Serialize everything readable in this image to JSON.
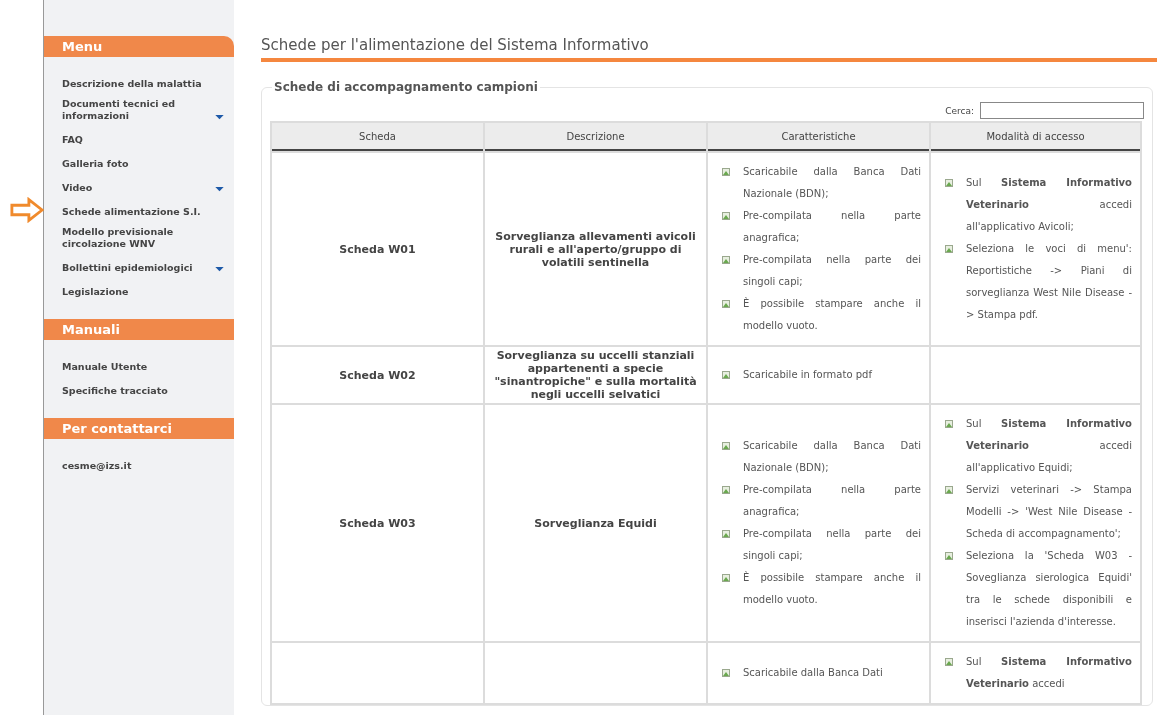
{
  "sidebar": {
    "sections": [
      {
        "title": "Menu",
        "items": [
          {
            "label": "Descrizione della malattia",
            "expandable": false,
            "selected": false
          },
          {
            "label": "Documenti tecnici ed informazioni",
            "expandable": true,
            "selected": false
          },
          {
            "label": "FAQ",
            "expandable": false,
            "selected": false
          },
          {
            "label": "Galleria foto",
            "expandable": false,
            "selected": false
          },
          {
            "label": "Video",
            "expandable": true,
            "selected": false
          },
          {
            "label": "Schede alimentazione S.I.",
            "expandable": false,
            "selected": true
          },
          {
            "label": "Modello previsionale circolazione WNV",
            "expandable": false,
            "selected": false
          },
          {
            "label": "Bollettini epidemiologici",
            "expandable": true,
            "selected": false
          },
          {
            "label": "Legislazione",
            "expandable": false,
            "selected": false
          }
        ]
      },
      {
        "title": "Manuali",
        "items": [
          {
            "label": "Manuale Utente",
            "expandable": false,
            "selected": false
          },
          {
            "label": "Specifiche tracciato",
            "expandable": false,
            "selected": false
          }
        ]
      },
      {
        "title": "Per contattarci",
        "items": [
          {
            "label": "cesme@izs.it",
            "expandable": false,
            "selected": false
          }
        ]
      }
    ]
  },
  "page_title": "Schede per l'alimentazione del Sistema Informativo",
  "fieldset": {
    "legend": "Schede di accompagnamento campioni",
    "search": {
      "label": "Cerca:"
    },
    "table": {
      "columns": [
        "Scheda",
        "Descrizione",
        "Caratteristiche",
        "Modalità di accesso"
      ],
      "rows": [
        {
          "scheda": "Scheda W01",
          "descrizione": "Sorveglianza allevamenti avicoli rurali e all'aperto/gruppo di volatili sentinella",
          "caratteristiche": [
            "Scaricabile dalla Banca Dati Nazionale (BDN);",
            "Pre-compilata nella parte anagrafica;",
            "Pre-compilata nella parte dei singoli capi;",
            "È possibile stampare anche il modello vuoto."
          ],
          "accesso": [
            "Sul **Sistema Informativo Veterinario** accedi all'applicativo Avicoli;",
            "Seleziona le voci di menu': Reportistiche -> Piani di sorveglianza West Nile Disease -> Stampa pdf."
          ]
        },
        {
          "scheda": "Scheda W02",
          "descrizione": "Sorveglianza su uccelli stanziali appartenenti a specie \"sinantropiche\" e sulla mortalità negli uccelli selvatici",
          "caratteristiche": [
            "Scaricabile in formato pdf"
          ]
        },
        {
          "scheda": "Scheda W03",
          "descrizione": "Sorveglianza Equidi",
          "caratteristiche": [
            "Scaricabile dalla Banca Dati Nazionale (BDN);",
            "Pre-compilata nella parte anagrafica;",
            "Pre-compilata nella parte dei singoli capi;",
            "È possibile stampare anche il modello vuoto."
          ],
          "accesso": [
            "Sul **Sistema Informativo Veterinario** accedi all'applicativo Equidi;",
            "Servizi veterinari -> Stampa Modelli -> 'West Nile Disease - Scheda di accompagnamento';",
            "Seleziona la 'Scheda W03 - Soveglianza sierologica Equidi' tra le schede disponibili e inserisci l'azienda d'interesse."
          ]
        },
        {
          "caratteristiche": [
            "Scaricabile dalla Banca Dati"
          ],
          "accesso": [
            "Sul **Sistema Informativo Veterinario** accedi"
          ]
        }
      ]
    }
  }
}
